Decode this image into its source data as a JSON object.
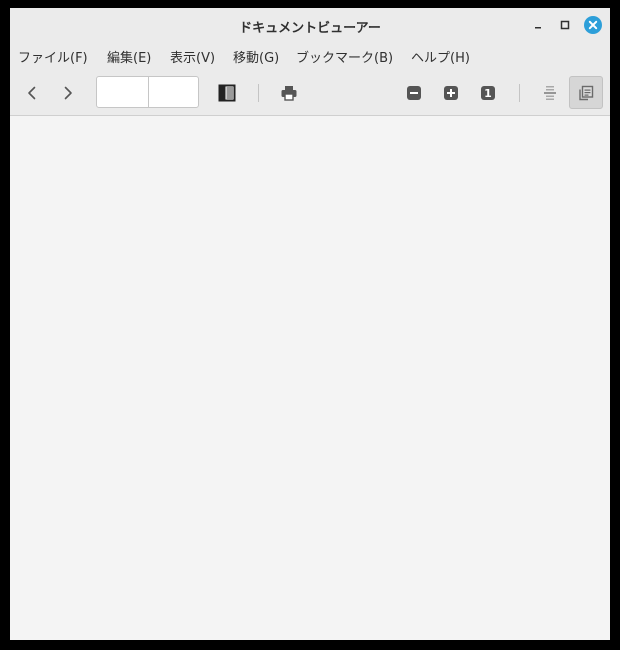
{
  "window": {
    "title": "ドキュメントビューアー"
  },
  "menu": {
    "items": [
      {
        "label": "ファイル(F)"
      },
      {
        "label": "編集(E)"
      },
      {
        "label": "表示(V)"
      },
      {
        "label": "移動(G)"
      },
      {
        "label": "ブックマーク(B)"
      },
      {
        "label": "ヘルプ(H)"
      }
    ]
  },
  "toolbar": {
    "page_current": "",
    "page_total": "",
    "icons": [
      "back-icon",
      "forward-icon",
      "sidebar-icon",
      "print-icon",
      "zoom-out-icon",
      "zoom-in-icon",
      "zoom-original-icon",
      "continuous-icon",
      "dual-page-icon"
    ],
    "zoom_original_glyph": "1"
  },
  "colors": {
    "close_button": "#2d9fd9",
    "window_bg": "#f4f4f4",
    "chrome_bg": "#ebebeb",
    "icon": "#555555"
  }
}
